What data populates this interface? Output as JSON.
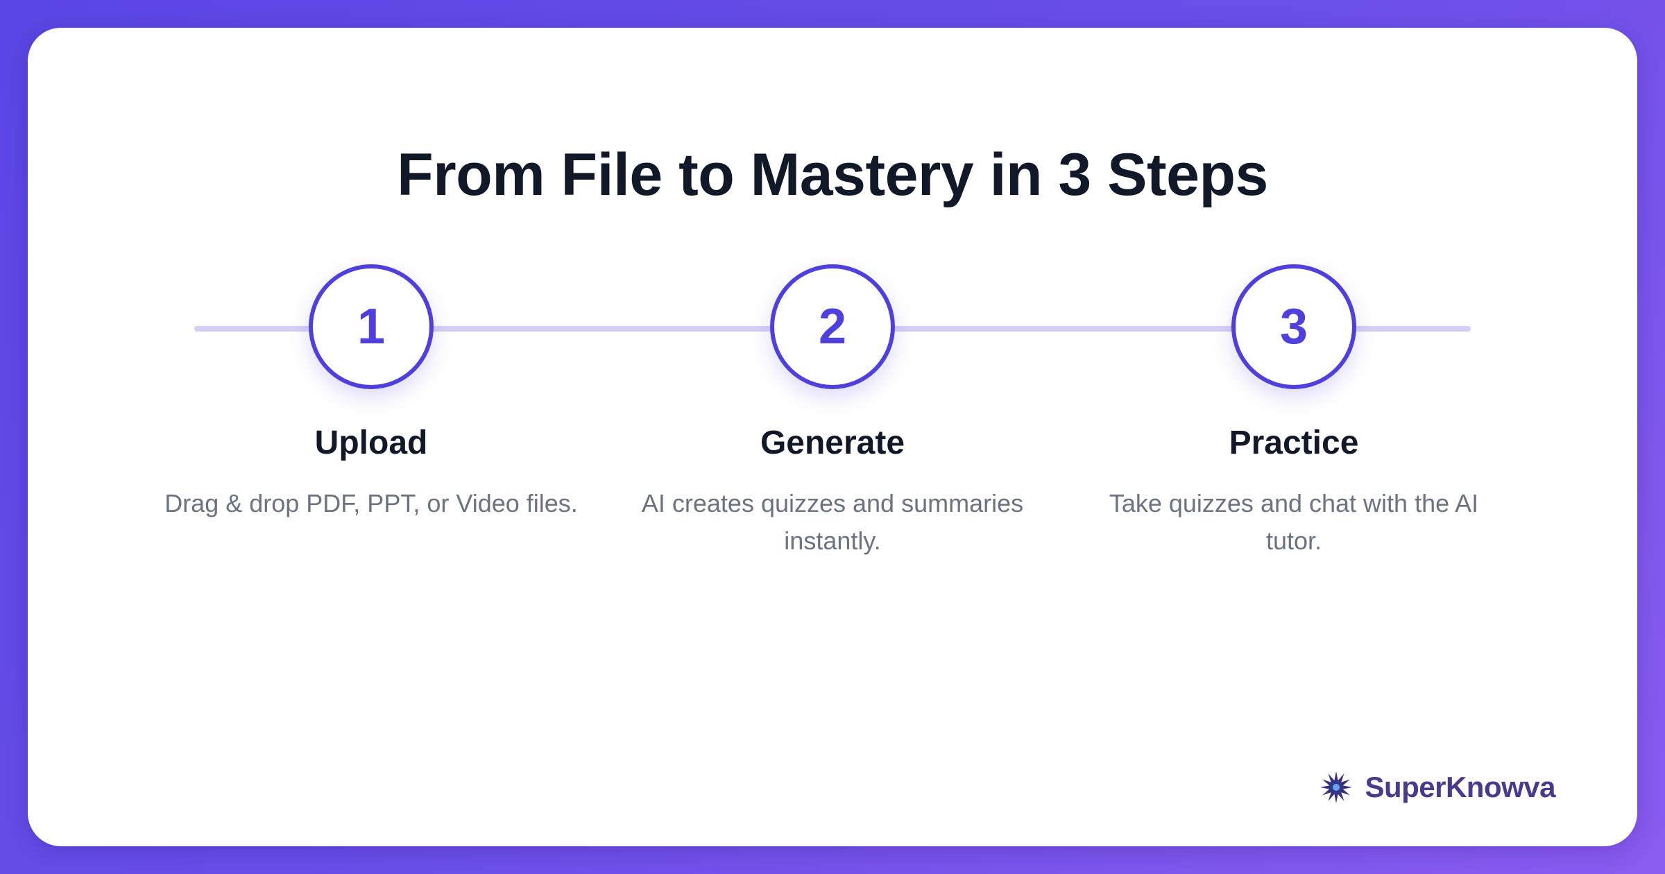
{
  "heading": "From File to Mastery in 3 Steps",
  "steps": [
    {
      "number": "1",
      "title": "Upload",
      "description": "Drag & drop PDF, PPT, or Video files."
    },
    {
      "number": "2",
      "title": "Generate",
      "description": "AI creates quizzes and summaries instantly."
    },
    {
      "number": "3",
      "title": "Practice",
      "description": "Take quizzes and chat with the AI tutor."
    }
  ],
  "brand": {
    "name": "SuperKnowva",
    "icon": "starburst-logo-icon"
  },
  "colors": {
    "accent": "#4f3fdc",
    "track": "#d4d0f5",
    "heading": "#111827",
    "muted": "#6b7280",
    "brand": "#4b3a8c",
    "background_start": "#5a46e4",
    "background_end": "#8a5cf0"
  }
}
